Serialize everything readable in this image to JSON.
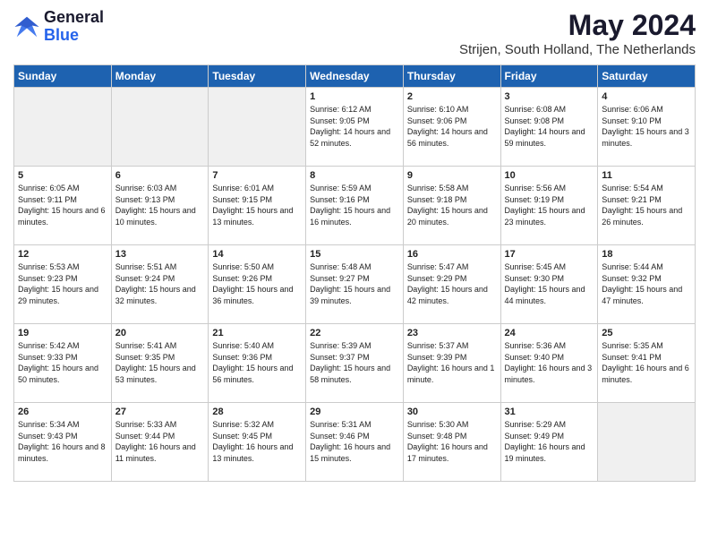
{
  "logo": {
    "general": "General",
    "blue": "Blue"
  },
  "title": {
    "month_year": "May 2024",
    "location": "Strijen, South Holland, The Netherlands"
  },
  "headers": [
    "Sunday",
    "Monday",
    "Tuesday",
    "Wednesday",
    "Thursday",
    "Friday",
    "Saturday"
  ],
  "weeks": [
    [
      {
        "day": "",
        "info": ""
      },
      {
        "day": "",
        "info": ""
      },
      {
        "day": "",
        "info": ""
      },
      {
        "day": "1",
        "info": "Sunrise: 6:12 AM\nSunset: 9:05 PM\nDaylight: 14 hours and 52 minutes."
      },
      {
        "day": "2",
        "info": "Sunrise: 6:10 AM\nSunset: 9:06 PM\nDaylight: 14 hours and 56 minutes."
      },
      {
        "day": "3",
        "info": "Sunrise: 6:08 AM\nSunset: 9:08 PM\nDaylight: 14 hours and 59 minutes."
      },
      {
        "day": "4",
        "info": "Sunrise: 6:06 AM\nSunset: 9:10 PM\nDaylight: 15 hours and 3 minutes."
      }
    ],
    [
      {
        "day": "5",
        "info": "Sunrise: 6:05 AM\nSunset: 9:11 PM\nDaylight: 15 hours and 6 minutes."
      },
      {
        "day": "6",
        "info": "Sunrise: 6:03 AM\nSunset: 9:13 PM\nDaylight: 15 hours and 10 minutes."
      },
      {
        "day": "7",
        "info": "Sunrise: 6:01 AM\nSunset: 9:15 PM\nDaylight: 15 hours and 13 minutes."
      },
      {
        "day": "8",
        "info": "Sunrise: 5:59 AM\nSunset: 9:16 PM\nDaylight: 15 hours and 16 minutes."
      },
      {
        "day": "9",
        "info": "Sunrise: 5:58 AM\nSunset: 9:18 PM\nDaylight: 15 hours and 20 minutes."
      },
      {
        "day": "10",
        "info": "Sunrise: 5:56 AM\nSunset: 9:19 PM\nDaylight: 15 hours and 23 minutes."
      },
      {
        "day": "11",
        "info": "Sunrise: 5:54 AM\nSunset: 9:21 PM\nDaylight: 15 hours and 26 minutes."
      }
    ],
    [
      {
        "day": "12",
        "info": "Sunrise: 5:53 AM\nSunset: 9:23 PM\nDaylight: 15 hours and 29 minutes."
      },
      {
        "day": "13",
        "info": "Sunrise: 5:51 AM\nSunset: 9:24 PM\nDaylight: 15 hours and 32 minutes."
      },
      {
        "day": "14",
        "info": "Sunrise: 5:50 AM\nSunset: 9:26 PM\nDaylight: 15 hours and 36 minutes."
      },
      {
        "day": "15",
        "info": "Sunrise: 5:48 AM\nSunset: 9:27 PM\nDaylight: 15 hours and 39 minutes."
      },
      {
        "day": "16",
        "info": "Sunrise: 5:47 AM\nSunset: 9:29 PM\nDaylight: 15 hours and 42 minutes."
      },
      {
        "day": "17",
        "info": "Sunrise: 5:45 AM\nSunset: 9:30 PM\nDaylight: 15 hours and 44 minutes."
      },
      {
        "day": "18",
        "info": "Sunrise: 5:44 AM\nSunset: 9:32 PM\nDaylight: 15 hours and 47 minutes."
      }
    ],
    [
      {
        "day": "19",
        "info": "Sunrise: 5:42 AM\nSunset: 9:33 PM\nDaylight: 15 hours and 50 minutes."
      },
      {
        "day": "20",
        "info": "Sunrise: 5:41 AM\nSunset: 9:35 PM\nDaylight: 15 hours and 53 minutes."
      },
      {
        "day": "21",
        "info": "Sunrise: 5:40 AM\nSunset: 9:36 PM\nDaylight: 15 hours and 56 minutes."
      },
      {
        "day": "22",
        "info": "Sunrise: 5:39 AM\nSunset: 9:37 PM\nDaylight: 15 hours and 58 minutes."
      },
      {
        "day": "23",
        "info": "Sunrise: 5:37 AM\nSunset: 9:39 PM\nDaylight: 16 hours and 1 minute."
      },
      {
        "day": "24",
        "info": "Sunrise: 5:36 AM\nSunset: 9:40 PM\nDaylight: 16 hours and 3 minutes."
      },
      {
        "day": "25",
        "info": "Sunrise: 5:35 AM\nSunset: 9:41 PM\nDaylight: 16 hours and 6 minutes."
      }
    ],
    [
      {
        "day": "26",
        "info": "Sunrise: 5:34 AM\nSunset: 9:43 PM\nDaylight: 16 hours and 8 minutes."
      },
      {
        "day": "27",
        "info": "Sunrise: 5:33 AM\nSunset: 9:44 PM\nDaylight: 16 hours and 11 minutes."
      },
      {
        "day": "28",
        "info": "Sunrise: 5:32 AM\nSunset: 9:45 PM\nDaylight: 16 hours and 13 minutes."
      },
      {
        "day": "29",
        "info": "Sunrise: 5:31 AM\nSunset: 9:46 PM\nDaylight: 16 hours and 15 minutes."
      },
      {
        "day": "30",
        "info": "Sunrise: 5:30 AM\nSunset: 9:48 PM\nDaylight: 16 hours and 17 minutes."
      },
      {
        "day": "31",
        "info": "Sunrise: 5:29 AM\nSunset: 9:49 PM\nDaylight: 16 hours and 19 minutes."
      },
      {
        "day": "",
        "info": ""
      }
    ]
  ]
}
